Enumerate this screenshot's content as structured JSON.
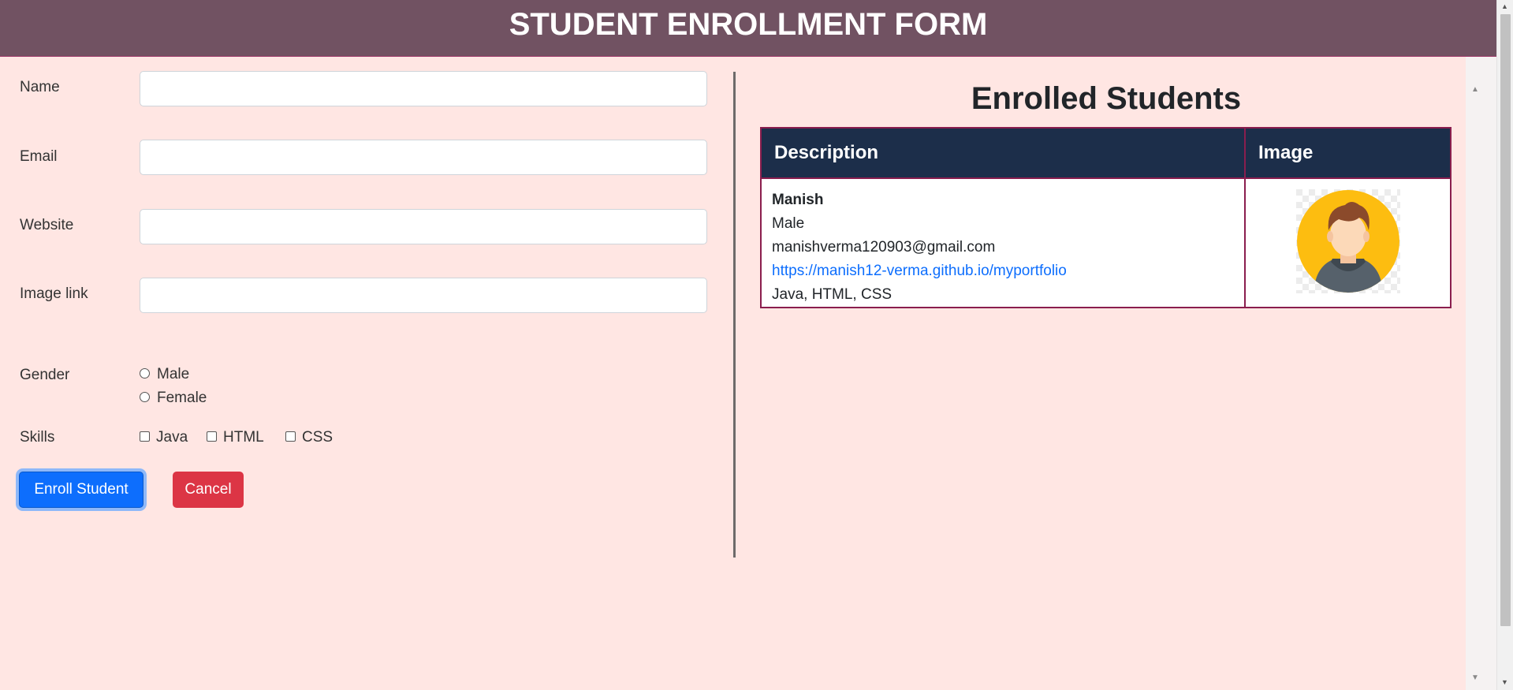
{
  "header": {
    "title": "STUDENT ENROLLMENT FORM"
  },
  "form": {
    "name_label": "Name",
    "name_value": "",
    "email_label": "Email",
    "email_value": "",
    "website_label": "Website",
    "website_value": "",
    "image_label": "Image link",
    "image_value": "",
    "gender_label": "Gender",
    "gender_options": [
      "Male",
      "Female"
    ],
    "skills_label": "Skills",
    "skills_options": [
      "Java",
      "HTML",
      "CSS"
    ],
    "enroll_button": "Enroll Student",
    "cancel_button": "Cancel"
  },
  "enrolled": {
    "title": "Enrolled Students",
    "columns": [
      "Description",
      "Image"
    ],
    "students": [
      {
        "name": "Manish",
        "gender": "Male",
        "email": "manishverma120903@gmail.com",
        "website": "https://manish12-verma.github.io/myportfolio",
        "skills": "Java, HTML, CSS",
        "image": "male-avatar-icon"
      }
    ]
  },
  "colors": {
    "header_bg": "#715262",
    "page_bg": "#ffe6e3",
    "table_header_bg": "#1c2e4a",
    "table_border": "#8a1e4e",
    "enroll_button": "#0d6efd",
    "cancel_button": "#dc3545",
    "link": "#0d6efd"
  }
}
